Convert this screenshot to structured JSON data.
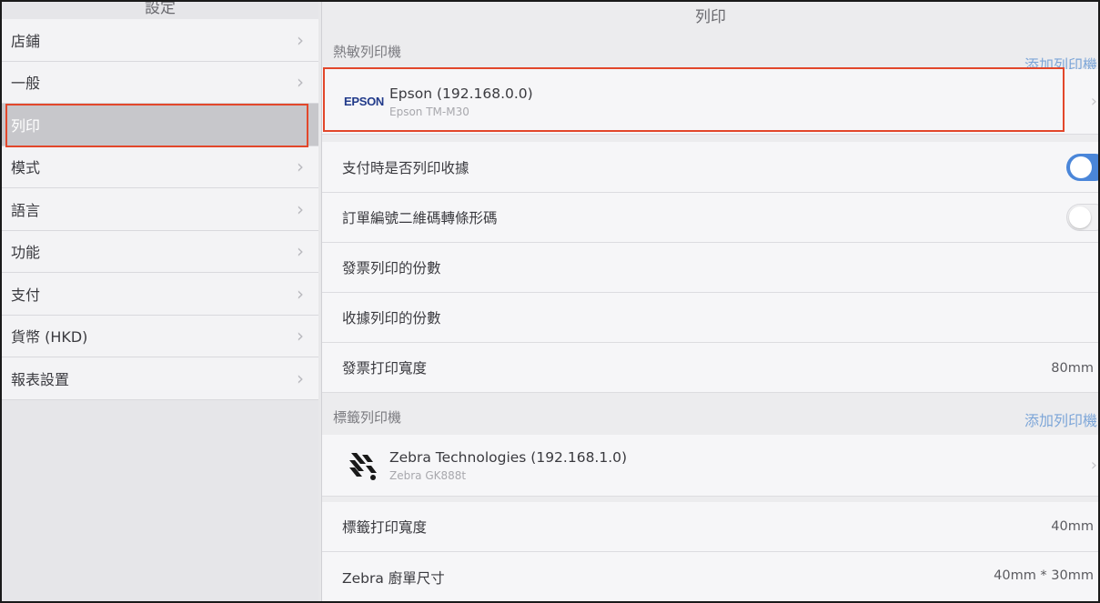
{
  "sidebar": {
    "title": "設定",
    "items": [
      {
        "label": "店鋪"
      },
      {
        "label": "一般"
      },
      {
        "label": "列印"
      },
      {
        "label": "模式"
      },
      {
        "label": "語言"
      },
      {
        "label": "功能"
      },
      {
        "label": "支付"
      },
      {
        "label": "貨幣 (HKD)"
      },
      {
        "label": "報表設置"
      }
    ],
    "selected": "列印"
  },
  "main": {
    "title": "列印",
    "thermal": {
      "header": "熱敏列印機",
      "add_label": "添加列印機",
      "printer": {
        "brand_logo": "EPSON",
        "name": "Epson (192.168.0.0)",
        "model": "Epson TM-M30"
      }
    },
    "settings": {
      "print_receipt": {
        "label": "支付時是否列印收據",
        "enabled": true
      },
      "barcode": {
        "label": "訂單編號二維碼轉條形碼",
        "enabled": false
      },
      "invoice_copies": {
        "label": "發票列印的份數"
      },
      "receipt_copies": {
        "label": "收據列印的份數"
      },
      "invoice_width": {
        "label": "發票打印寬度",
        "value": "80mm"
      }
    },
    "label_printer": {
      "header": "標籤列印機",
      "add_label": "添加列印機",
      "printer": {
        "name": "Zebra Technologies (192.168.1.0)",
        "model": "Zebra GK888t"
      },
      "label_width": {
        "label": "標籤打印寬度",
        "value": "40mm"
      },
      "kitchen_size": {
        "label": "Zebra 廚單尺寸",
        "value": "40mm * 30mm"
      }
    }
  },
  "colors": {
    "accent": "#4a86d9",
    "highlight_border": "#e2472b"
  }
}
